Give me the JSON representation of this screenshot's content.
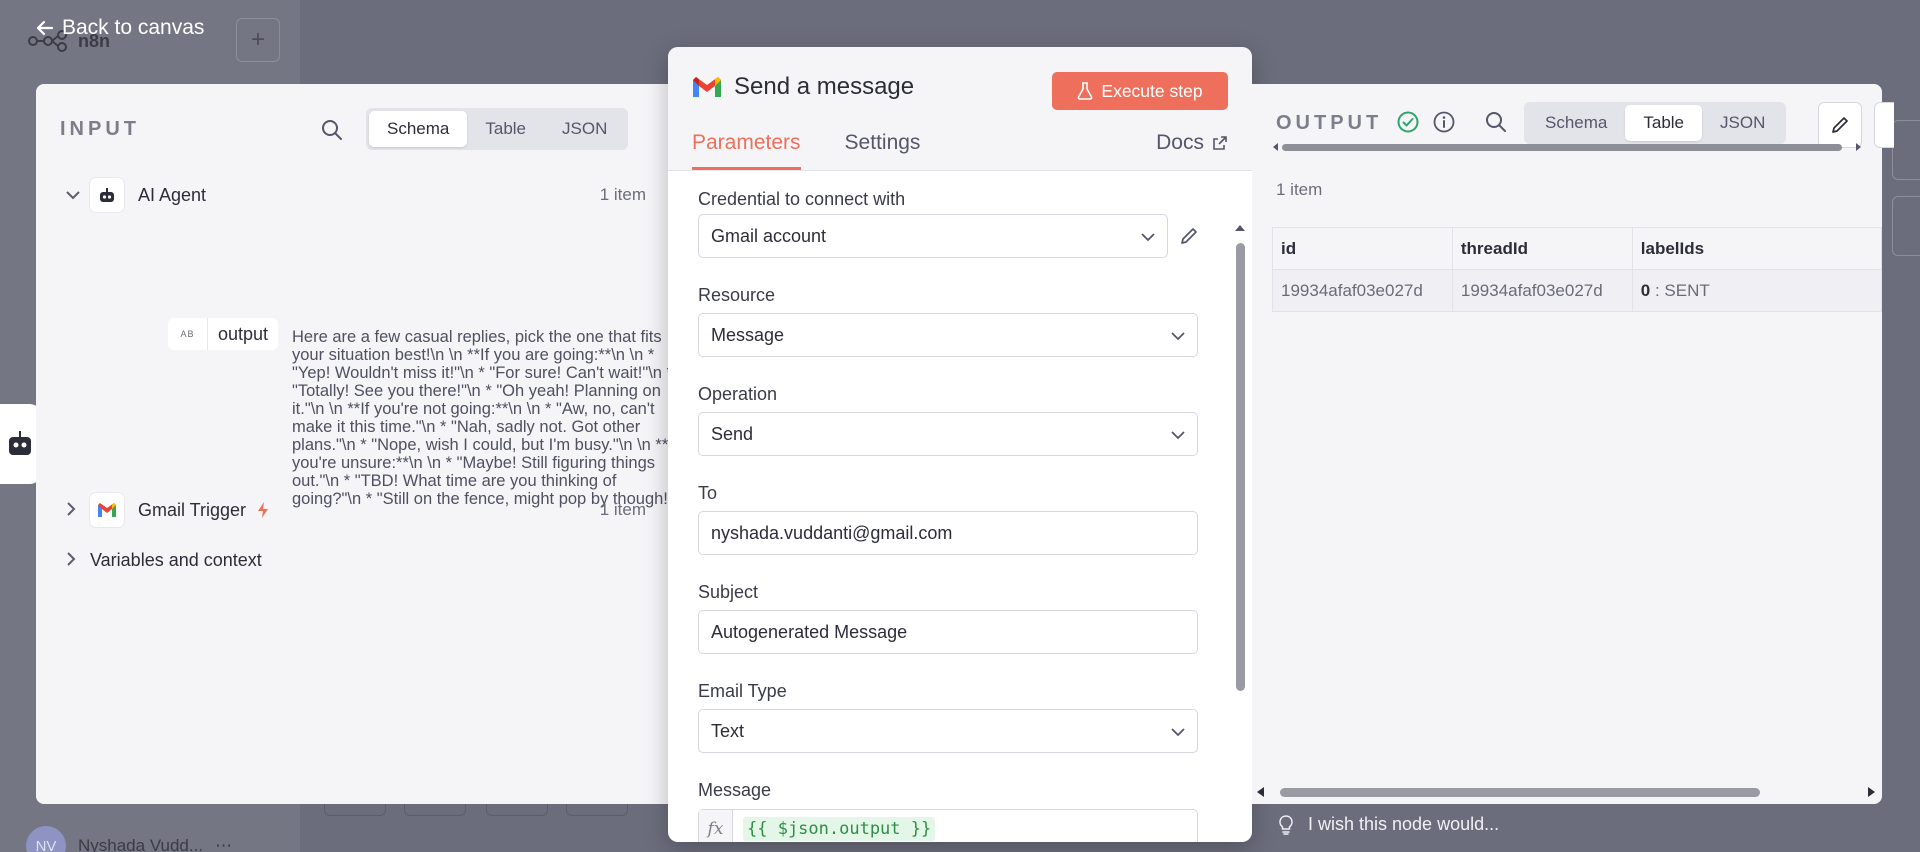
{
  "background": {
    "logo_text": "n8n",
    "user_initials": "NV",
    "user_name": "Nyshada Vudd...",
    "user_menu": "⋯"
  },
  "nav": {
    "back_label": "Back to canvas"
  },
  "input_panel": {
    "title": "INPUT",
    "views": [
      "Schema",
      "Table",
      "JSON"
    ],
    "active_view": "Schema",
    "nodes": [
      {
        "name": "AI Agent",
        "count": "1 item",
        "expanded": true
      },
      {
        "name": "Gmail Trigger",
        "count": "1 item",
        "expanded": false
      }
    ],
    "field_name": "output",
    "field_type": "AB",
    "output_value": "Here are a few casual replies, pick the one that fits your situation best!\\n \\n **If you are going:**\\n \\n * \"Yep! Wouldn't miss it!\"\\n * \"For sure! Can't wait!\"\\n * \"Totally! See you there!\"\\n * \"Oh yeah! Planning on it.\"\\n \\n **If you're not going:**\\n \\n * \"Aw, no, can't make it this time.\"\\n * \"Nah, sadly not. Got other plans.\"\\n * \"Nope, wish I could, but I'm busy.\"\\n \\n **If you're unsure:**\\n \\n * \"Maybe! Still figuring things out.\"\\n * \"TBD! What time are you thinking of going?\"\\n * \"Still on the fence, might pop by though!\"",
    "variables_label": "Variables and context"
  },
  "node": {
    "title": "Send a message",
    "execute_label": "Execute step",
    "tabs": [
      "Parameters",
      "Settings"
    ],
    "active_tab": "Parameters",
    "docs_label": "Docs",
    "fields": {
      "credential_label": "Credential to connect with",
      "credential_value": "Gmail account",
      "resource_label": "Resource",
      "resource_value": "Message",
      "operation_label": "Operation",
      "operation_value": "Send",
      "to_label": "To",
      "to_value": "nyshada.vuddanti@gmail.com",
      "subject_label": "Subject",
      "subject_value": "Autogenerated Message",
      "email_type_label": "Email Type",
      "email_type_value": "Text",
      "message_label": "Message",
      "message_value": "{{ $json.output }}"
    }
  },
  "output_panel": {
    "title": "OUTPUT",
    "views": [
      "Schema",
      "Table",
      "JSON"
    ],
    "active_view": "Table",
    "item_count": "1 item",
    "columns": [
      "id",
      "threadId",
      "labelIds"
    ],
    "rows": [
      {
        "id": "19934afaf03e027d",
        "threadId": "19934afaf03e027d",
        "label_index": "0",
        "label_value": ": SENT"
      }
    ]
  },
  "feedback": {
    "label": "I wish this node would..."
  },
  "colors": {
    "accent": "#ee6f5b",
    "success": "#2ea56a"
  }
}
